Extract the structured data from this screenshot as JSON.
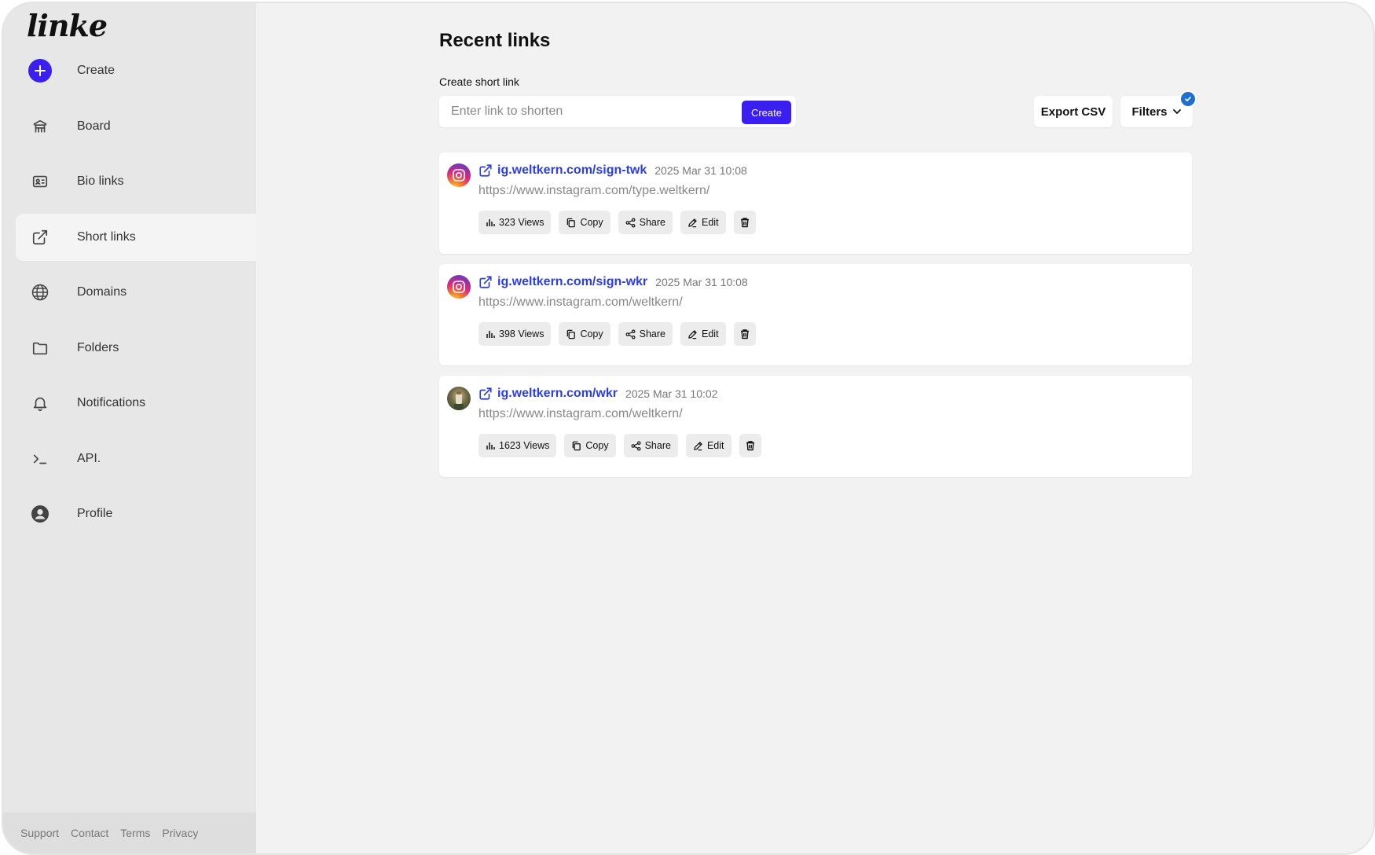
{
  "app": {
    "logo": "linke"
  },
  "sidebar": {
    "items": [
      {
        "label": "Create",
        "icon": "plus-circle-icon"
      },
      {
        "label": "Board",
        "icon": "board-icon"
      },
      {
        "label": "Bio links",
        "icon": "id-card-icon"
      },
      {
        "label": "Short links",
        "icon": "external-link-icon",
        "active": true
      },
      {
        "label": "Domains",
        "icon": "globe-icon"
      },
      {
        "label": "Folders",
        "icon": "folder-icon"
      },
      {
        "label": "Notifications",
        "icon": "bell-icon"
      },
      {
        "label": "API.",
        "icon": "terminal-icon"
      },
      {
        "label": "Profile",
        "icon": "user-circle-icon"
      }
    ],
    "footer": [
      "Support",
      "Contact",
      "Terms",
      "Privacy"
    ]
  },
  "main": {
    "title": "Recent links",
    "create_label": "Create short link",
    "input_placeholder": "Enter link to shorten",
    "create_button": "Create",
    "export_button": "Export CSV",
    "filters_button": "Filters"
  },
  "links": [
    {
      "short_url": "ig.weltkern.com/sign-twk",
      "date": "2025 Mar 31 10:08",
      "long_url": "https://www.instagram.com/type.weltkern/",
      "views": "323 Views",
      "avatar": "instagram-icon"
    },
    {
      "short_url": "ig.weltkern.com/sign-wkr",
      "date": "2025 Mar 31 10:08",
      "long_url": "https://www.instagram.com/weltkern/",
      "views": "398 Views",
      "avatar": "instagram-icon"
    },
    {
      "short_url": "ig.weltkern.com/wkr",
      "date": "2025 Mar 31 10:02",
      "long_url": "https://www.instagram.com/weltkern/",
      "views": "1623 Views",
      "avatar": "profile-photo"
    }
  ],
  "actions": {
    "copy": "Copy",
    "share": "Share",
    "edit": "Edit"
  },
  "colors": {
    "accent": "#3b1ff0",
    "link": "#2b3ee6",
    "badge": "#1f6fd1"
  }
}
